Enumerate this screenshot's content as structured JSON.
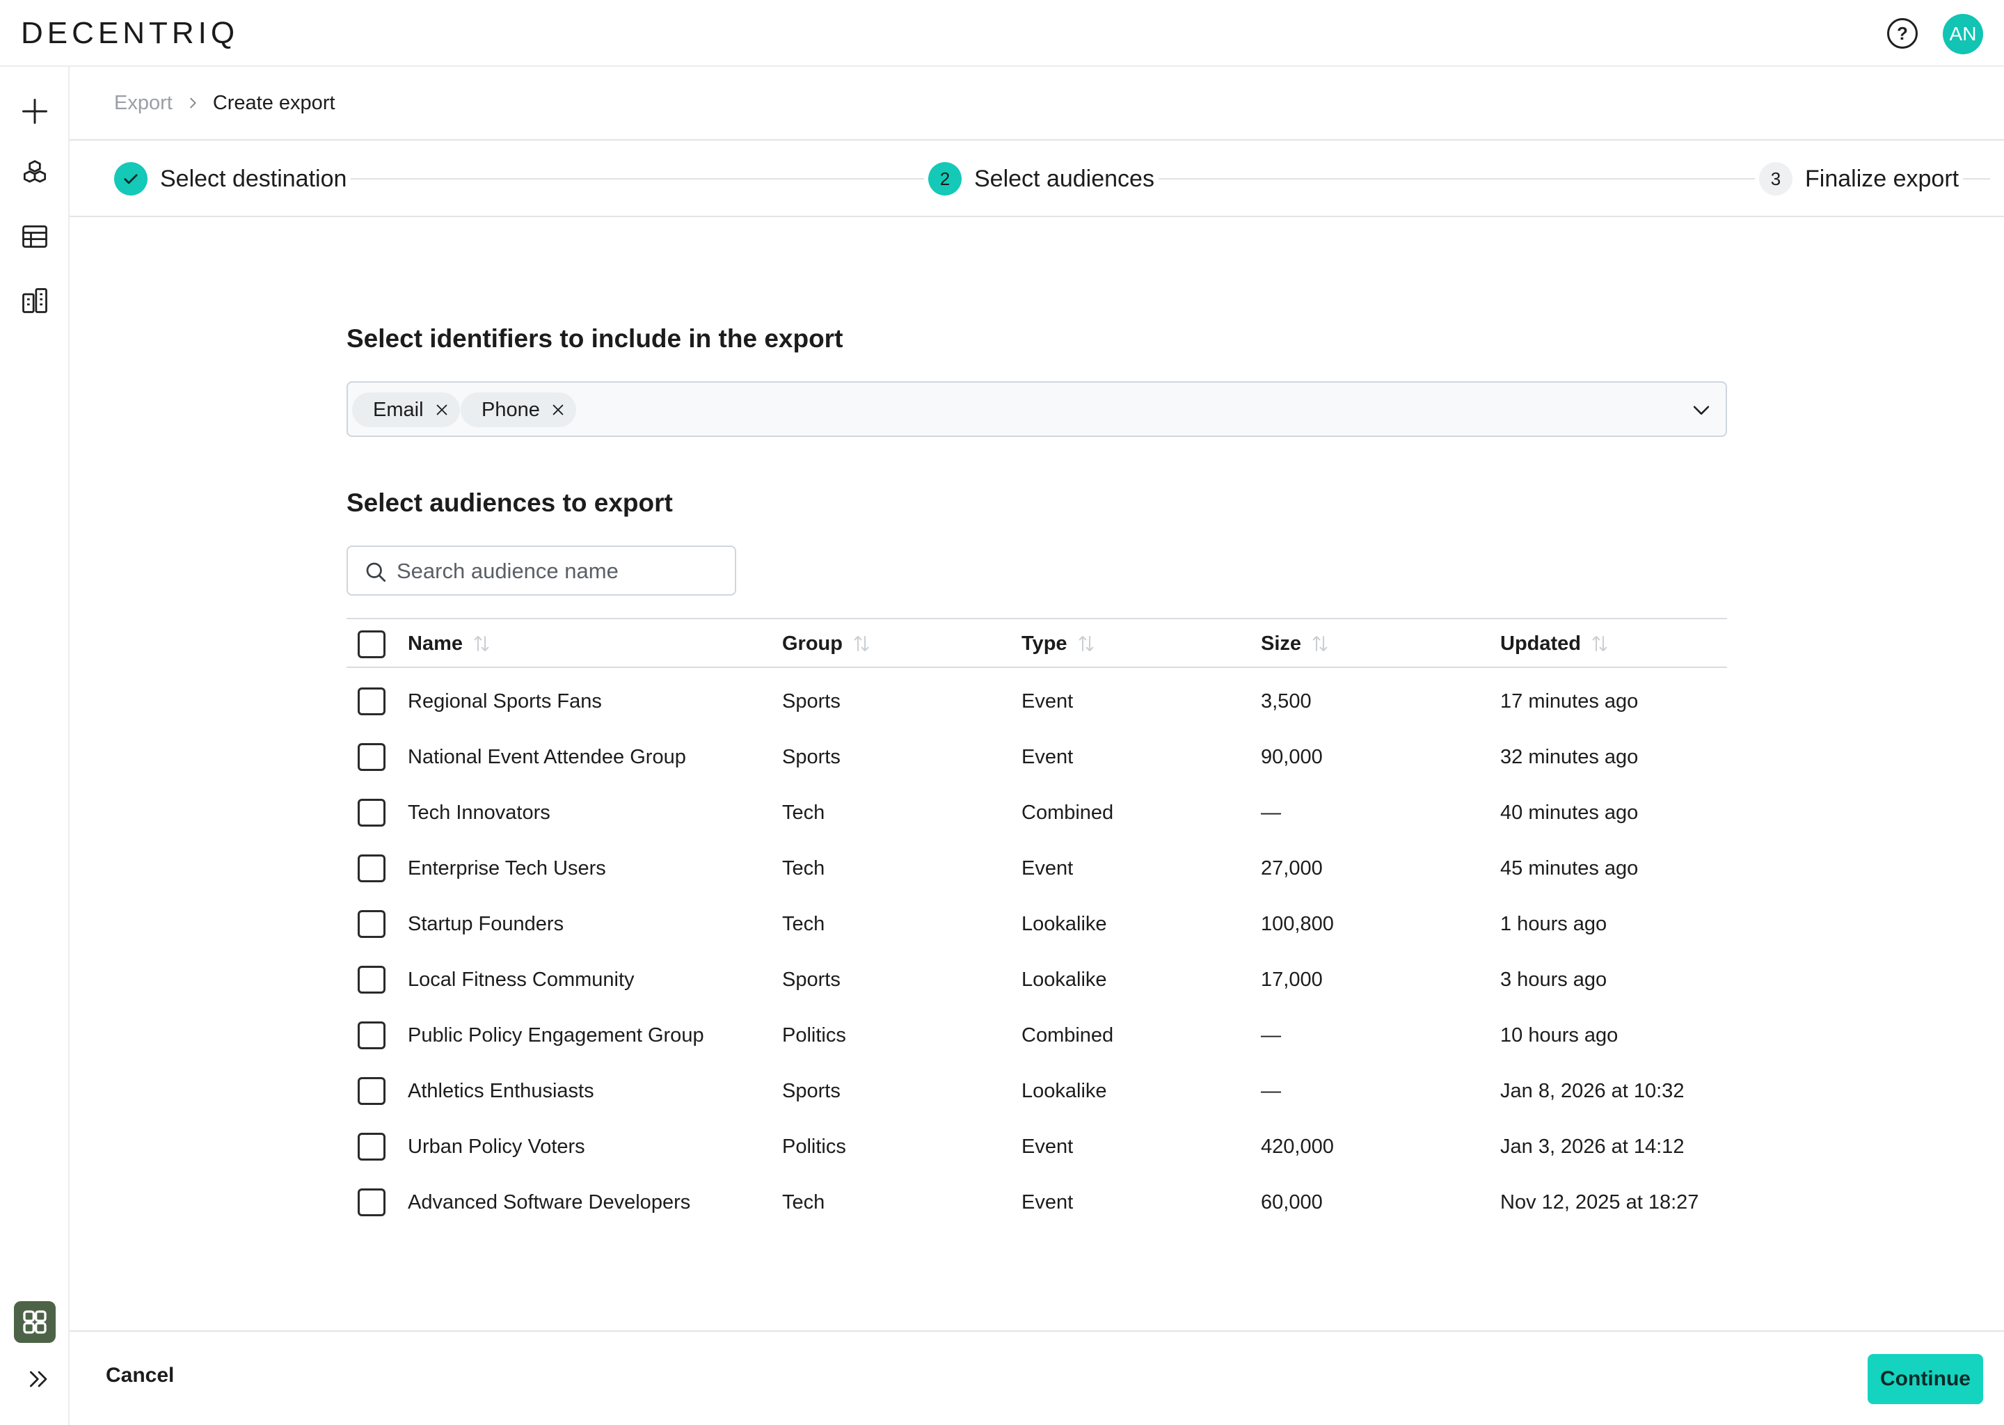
{
  "app": {
    "logo": "DECENTRIQ",
    "avatar_initials": "AN",
    "accent_color": "#14c9b7"
  },
  "header": {
    "help_icon": "help-circle-icon"
  },
  "sidebar": {
    "items": [
      {
        "icon": "plus-icon"
      },
      {
        "icon": "cubes-icon"
      },
      {
        "icon": "table-icon"
      },
      {
        "icon": "buildings-icon"
      }
    ],
    "bottom": [
      {
        "icon": "app-grid-icon"
      },
      {
        "icon": "expand-chevrons-icon"
      }
    ]
  },
  "breadcrumb": {
    "root": "Export",
    "current": "Create export"
  },
  "stepper": {
    "steps": [
      {
        "number": "1",
        "label": "Select destination",
        "state": "completed"
      },
      {
        "number": "2",
        "label": "Select audiences",
        "state": "active"
      },
      {
        "number": "3",
        "label": "Finalize export",
        "state": "pending"
      }
    ]
  },
  "identifiers": {
    "title": "Select  identifiers to include in the export",
    "selected": [
      "Email",
      "Phone"
    ]
  },
  "audiences": {
    "title": "Select audiences to export",
    "search_placeholder": "Search audience name",
    "search_value": "",
    "columns": [
      "Name",
      "Group",
      "Type",
      "Size",
      "Updated"
    ],
    "rows": [
      {
        "name": "Regional Sports Fans",
        "group": "Sports",
        "type": "Event",
        "size": "3,500",
        "updated": "17 minutes ago",
        "checked": false
      },
      {
        "name": "National Event Attendee Group",
        "group": "Sports",
        "type": "Event",
        "size": "90,000",
        "updated": "32 minutes ago",
        "checked": false
      },
      {
        "name": "Tech Innovators",
        "group": "Tech",
        "type": "Combined",
        "size": "—",
        "updated": "40 minutes ago",
        "checked": false
      },
      {
        "name": "Enterprise Tech Users",
        "group": "Tech",
        "type": "Event",
        "size": "27,000",
        "updated": "45 minutes ago",
        "checked": false
      },
      {
        "name": "Startup Founders",
        "group": "Tech",
        "type": "Lookalike",
        "size": "100,800",
        "updated": "1 hours ago",
        "checked": false
      },
      {
        "name": "Local Fitness Community",
        "group": "Sports",
        "type": "Lookalike",
        "size": "17,000",
        "updated": "3 hours ago",
        "checked": false
      },
      {
        "name": "Public Policy Engagement Group",
        "group": "Politics",
        "type": "Combined",
        "size": "—",
        "updated": "10 hours ago",
        "checked": false
      },
      {
        "name": "Athletics Enthusiasts",
        "group": "Sports",
        "type": "Lookalike",
        "size": "—",
        "updated": "Jan 8, 2026 at 10:32",
        "checked": false
      },
      {
        "name": "Urban Policy Voters",
        "group": "Politics",
        "type": "Event",
        "size": "420,000",
        "updated": "Jan 3, 2026 at 14:12",
        "checked": false
      },
      {
        "name": "Advanced Software Developers",
        "group": "Tech",
        "type": "Event",
        "size": "60,000",
        "updated": "Nov 12, 2025 at 18:27",
        "checked": false
      }
    ]
  },
  "footer": {
    "cancel_label": "Cancel",
    "continue_label": "Continue"
  }
}
